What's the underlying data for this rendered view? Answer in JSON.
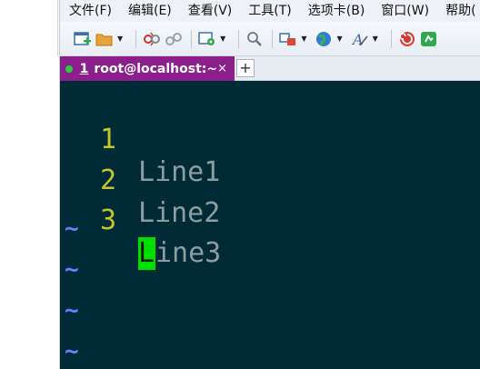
{
  "menu": [
    {
      "id": "file",
      "label": "文件(F)"
    },
    {
      "id": "edit",
      "label": "编辑(E)"
    },
    {
      "id": "view",
      "label": "查看(V)"
    },
    {
      "id": "tools",
      "label": "工具(T)"
    },
    {
      "id": "tabs",
      "label": "选项卡(B)"
    },
    {
      "id": "window",
      "label": "窗口(W)"
    },
    {
      "id": "help",
      "label": "帮助("
    }
  ],
  "toolbar": {
    "icons": [
      "new-session-icon",
      "open-folder-icon",
      "disconnect-icon",
      "reconnect-icon",
      "settings-icon",
      "search-icon",
      "layout-icon",
      "globe-icon",
      "font-icon",
      "xshell-logo-icon",
      "xftp-icon"
    ]
  },
  "tab": {
    "index": "1",
    "title": "root@localhost:~",
    "close": "×",
    "add": "+",
    "status_color": "#2ecc40",
    "active_color": "#8b1f8b"
  },
  "terminal": {
    "lines": [
      {
        "num": "1",
        "text": "Line1"
      },
      {
        "num": "2",
        "text": "Line2"
      },
      {
        "num": "3",
        "cursor_char": "L",
        "text_rest": "ine3"
      }
    ],
    "tilde": "~",
    "background": "#002b36",
    "cursor_color": "#00e000"
  }
}
